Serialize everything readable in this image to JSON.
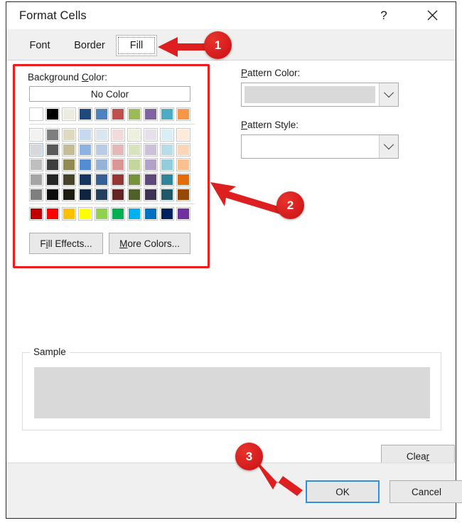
{
  "window": {
    "title": "Format Cells",
    "help_icon": "question-mark-icon",
    "help_label": "?",
    "close_icon": "close-x-icon"
  },
  "tabs": [
    {
      "label": "Font",
      "active": false
    },
    {
      "label": "Border",
      "active": false
    },
    {
      "label": "Fill",
      "active": true
    }
  ],
  "background_color": {
    "group_label_pre": "Background ",
    "group_label_accel": "C",
    "group_label_post": "olor:",
    "no_color_label": "No Color",
    "buttons": {
      "fill_effects_pre": "F",
      "fill_effects_accel": "i",
      "fill_effects_post": "ll Effects...",
      "more_colors_accel": "M",
      "more_colors_post": "ore Colors..."
    },
    "rows": [
      [
        "#ffffff",
        "#000000",
        "#eeece1",
        "#1f497d",
        "#4f81bd",
        "#c0504d",
        "#9bbb59",
        "#8064a2",
        "#4bacc6",
        "#f79646"
      ],
      [
        "#f2f2f2",
        "#7f7f7f",
        "#ddd9c3",
        "#c6d9f0",
        "#dbe5f1",
        "#f2dcdb",
        "#ebf1dd",
        "#e5e0ec",
        "#dbeef3",
        "#fdeada"
      ],
      [
        "#d8d8d8",
        "#595959",
        "#c4bd97",
        "#8db3e2",
        "#b8cce4",
        "#e5b8b7",
        "#d7e3bc",
        "#ccc1d9",
        "#b7dde8",
        "#fbd5b5"
      ],
      [
        "#bfbfbf",
        "#3f3f3f",
        "#938953",
        "#548dd4",
        "#95b3d7",
        "#d99694",
        "#c3d69b",
        "#b2a2c7",
        "#92cddc",
        "#fac08f"
      ],
      [
        "#a5a5a5",
        "#262626",
        "#494429",
        "#17365d",
        "#366092",
        "#953734",
        "#76923c",
        "#5f497a",
        "#31859b",
        "#e36c09"
      ],
      [
        "#7f7f7f",
        "#0c0c0c",
        "#1d1b10",
        "#0f243e",
        "#244061",
        "#632423",
        "#4f6128",
        "#3f3151",
        "#205867",
        "#974806"
      ],
      [
        "#c00000",
        "#ff0000",
        "#ffc000",
        "#ffff00",
        "#92d050",
        "#00b050",
        "#00b0f0",
        "#0070c0",
        "#002060",
        "#7030a0"
      ]
    ],
    "selected_row": 2,
    "selected_col": 0
  },
  "pattern": {
    "color_label_accel": "P",
    "color_label_post": "attern Color:",
    "color_value": "",
    "style_label_accel": "P",
    "style_label_post": "attern Style:",
    "style_value": "",
    "dropdown_icon": "chevron-down-icon"
  },
  "sample": {
    "caption": "Sample",
    "swatch_color": "#d9d9d9"
  },
  "actions": {
    "clear_pre": "Clea",
    "clear_accel": "r",
    "ok": "OK",
    "cancel": "Cancel"
  },
  "annotations": {
    "accent_color": "#dd1f1f",
    "markers": [
      {
        "label": "1",
        "points_to": "fill-tab"
      },
      {
        "label": "2",
        "points_to": "background-color-group"
      },
      {
        "label": "3",
        "points_to": "ok-button"
      }
    ],
    "highlight_box": "background-color-group"
  }
}
